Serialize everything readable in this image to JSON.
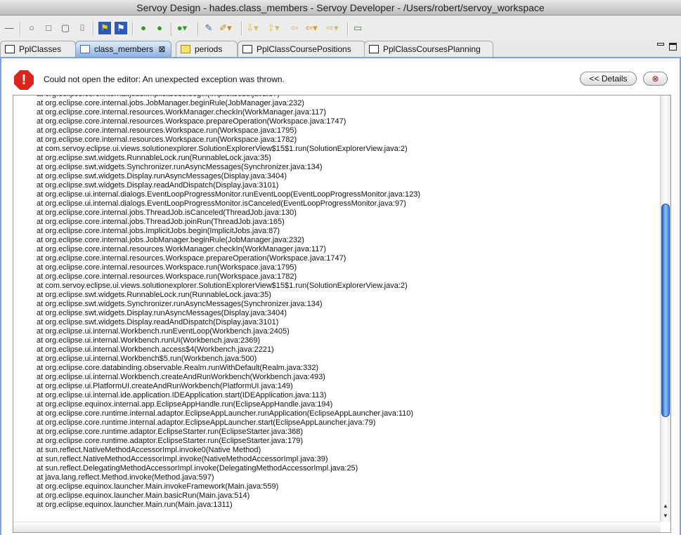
{
  "window": {
    "title": "Servoy Design - hades.class_members - Servoy Developer - /Users/robert/servoy_workspace"
  },
  "toolbar": {
    "icons": [
      "line-tool",
      "oval-tool",
      "rect-tool",
      "rounded-rect-tool",
      "text-tool",
      "debug-solution",
      "run-solution",
      "start-client",
      "start-web-client",
      "run-client-menu",
      "script-edit",
      "highlight-tool",
      "next-annotation",
      "previous-annotation",
      "last-edit-location",
      "back",
      "forward",
      "open-perspective"
    ]
  },
  "tabs": [
    {
      "label": "PplClasses",
      "active": false
    },
    {
      "label": "class_members",
      "active": true,
      "close": "⊠"
    },
    {
      "label": "periods",
      "active": false
    },
    {
      "label": "PplClassCoursePositions",
      "active": false
    },
    {
      "label": "PplClassCoursesPlanning",
      "active": false
    }
  ],
  "editor": {
    "message": "Could not open the editor: An unexpected exception was thrown.",
    "details_button": "<< Details",
    "scroll_position": 0.56,
    "stack_trace": [
      "at org.eclipse.core.internal.jobs.ImplicitJobs.begin(ImplicitJobs.java:87)",
      "at org.eclipse.core.internal.jobs.JobManager.beginRule(JobManager.java:232)",
      "at org.eclipse.core.internal.resources.WorkManager.checkIn(WorkManager.java:117)",
      "at org.eclipse.core.internal.resources.Workspace.prepareOperation(Workspace.java:1747)",
      "at org.eclipse.core.internal.resources.Workspace.run(Workspace.java:1795)",
      "at org.eclipse.core.internal.resources.Workspace.run(Workspace.java:1782)",
      "at com.servoy.eclipse.ui.views.solutionexplorer.SolutionExplorerView$15$1.run(SolutionExplorerView.java:2)",
      "at org.eclipse.swt.widgets.RunnableLock.run(RunnableLock.java:35)",
      "at org.eclipse.swt.widgets.Synchronizer.runAsyncMessages(Synchronizer.java:134)",
      "at org.eclipse.swt.widgets.Display.runAsyncMessages(Display.java:3404)",
      "at org.eclipse.swt.widgets.Display.readAndDispatch(Display.java:3101)",
      "at org.eclipse.ui.internal.dialogs.EventLoopProgressMonitor.runEventLoop(EventLoopProgressMonitor.java:123)",
      "at org.eclipse.ui.internal.dialogs.EventLoopProgressMonitor.isCanceled(EventLoopProgressMonitor.java:97)",
      "at org.eclipse.core.internal.jobs.ThreadJob.isCanceled(ThreadJob.java:130)",
      "at org.eclipse.core.internal.jobs.ThreadJob.joinRun(ThreadJob.java:165)",
      "at org.eclipse.core.internal.jobs.ImplicitJobs.begin(ImplicitJobs.java:87)",
      "at org.eclipse.core.internal.jobs.JobManager.beginRule(JobManager.java:232)",
      "at org.eclipse.core.internal.resources.WorkManager.checkIn(WorkManager.java:117)",
      "at org.eclipse.core.internal.resources.Workspace.prepareOperation(Workspace.java:1747)",
      "at org.eclipse.core.internal.resources.Workspace.run(Workspace.java:1795)",
      "at org.eclipse.core.internal.resources.Workspace.run(Workspace.java:1782)",
      "at com.servoy.eclipse.ui.views.solutionexplorer.SolutionExplorerView$15$1.run(SolutionExplorerView.java:2)",
      "at org.eclipse.swt.widgets.RunnableLock.run(RunnableLock.java:35)",
      "at org.eclipse.swt.widgets.Synchronizer.runAsyncMessages(Synchronizer.java:134)",
      "at org.eclipse.swt.widgets.Display.runAsyncMessages(Display.java:3404)",
      "at org.eclipse.swt.widgets.Display.readAndDispatch(Display.java:3101)",
      "at org.eclipse.ui.internal.Workbench.runEventLoop(Workbench.java:2405)",
      "at org.eclipse.ui.internal.Workbench.runUI(Workbench.java:2369)",
      "at org.eclipse.ui.internal.Workbench.access$4(Workbench.java:2221)",
      "at org.eclipse.ui.internal.Workbench$5.run(Workbench.java:500)",
      "at org.eclipse.core.databinding.observable.Realm.runWithDefault(Realm.java:332)",
      "at org.eclipse.ui.internal.Workbench.createAndRunWorkbench(Workbench.java:493)",
      "at org.eclipse.ui.PlatformUI.createAndRunWorkbench(PlatformUI.java:149)",
      "at org.eclipse.ui.internal.ide.application.IDEApplication.start(IDEApplication.java:113)",
      "at org.eclipse.equinox.internal.app.EclipseAppHandle.run(EclipseAppHandle.java:194)",
      "at org.eclipse.core.runtime.internal.adaptor.EclipseAppLauncher.runApplication(EclipseAppLauncher.java:110)",
      "at org.eclipse.core.runtime.internal.adaptor.EclipseAppLauncher.start(EclipseAppLauncher.java:79)",
      "at org.eclipse.core.runtime.adaptor.EclipseStarter.run(EclipseStarter.java:368)",
      "at org.eclipse.core.runtime.adaptor.EclipseStarter.run(EclipseStarter.java:179)",
      "at sun.reflect.NativeMethodAccessorImpl.invoke0(Native Method)",
      "at sun.reflect.NativeMethodAccessorImpl.invoke(NativeMethodAccessorImpl.java:39)",
      "at sun.reflect.DelegatingMethodAccessorImpl.invoke(DelegatingMethodAccessorImpl.java:25)",
      "at java.lang.reflect.Method.invoke(Method.java:597)",
      "at org.eclipse.equinox.launcher.Main.invokeFramework(Main.java:559)",
      "at org.eclipse.equinox.launcher.Main.basicRun(Main.java:514)",
      "at org.eclipse.equinox.launcher.Main.run(Main.java:1311)"
    ]
  }
}
